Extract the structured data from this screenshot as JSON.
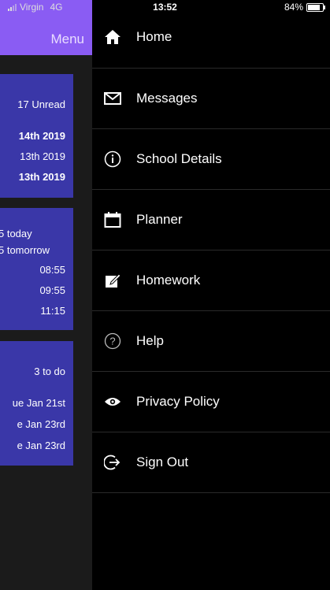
{
  "status_bar": {
    "carrier": "Virgin",
    "network": "4G",
    "time": "13:52",
    "battery_text": "84%",
    "battery_level": 0.84
  },
  "underlay": {
    "menu_label": "Menu",
    "messages_card": {
      "unread": "17 Unread",
      "lines": [
        "14th 2019",
        "13th 2019",
        "13th 2019"
      ]
    },
    "schedule_card": {
      "lines": [
        "5 today",
        "5 tomorrow",
        "08:55",
        "09:55",
        "11:15"
      ]
    },
    "homework_card": {
      "todo": "3 to do",
      "lines": [
        "ue Jan 21st",
        "e Jan 23rd",
        "e Jan 23rd"
      ]
    },
    "colors": {
      "header": "#8a5cf3",
      "card": "#3a37a8"
    }
  },
  "drawer": {
    "items": [
      {
        "label": "Home",
        "icon": "home-icon"
      },
      {
        "label": "Messages",
        "icon": "envelope-icon"
      },
      {
        "label": "School Details",
        "icon": "info-icon"
      },
      {
        "label": "Planner",
        "icon": "calendar-icon"
      },
      {
        "label": "Homework",
        "icon": "edit-icon"
      },
      {
        "label": "Help",
        "icon": "help-icon"
      },
      {
        "label": "Privacy Policy",
        "icon": "eye-icon"
      },
      {
        "label": "Sign Out",
        "icon": "sign-out-icon"
      }
    ]
  }
}
